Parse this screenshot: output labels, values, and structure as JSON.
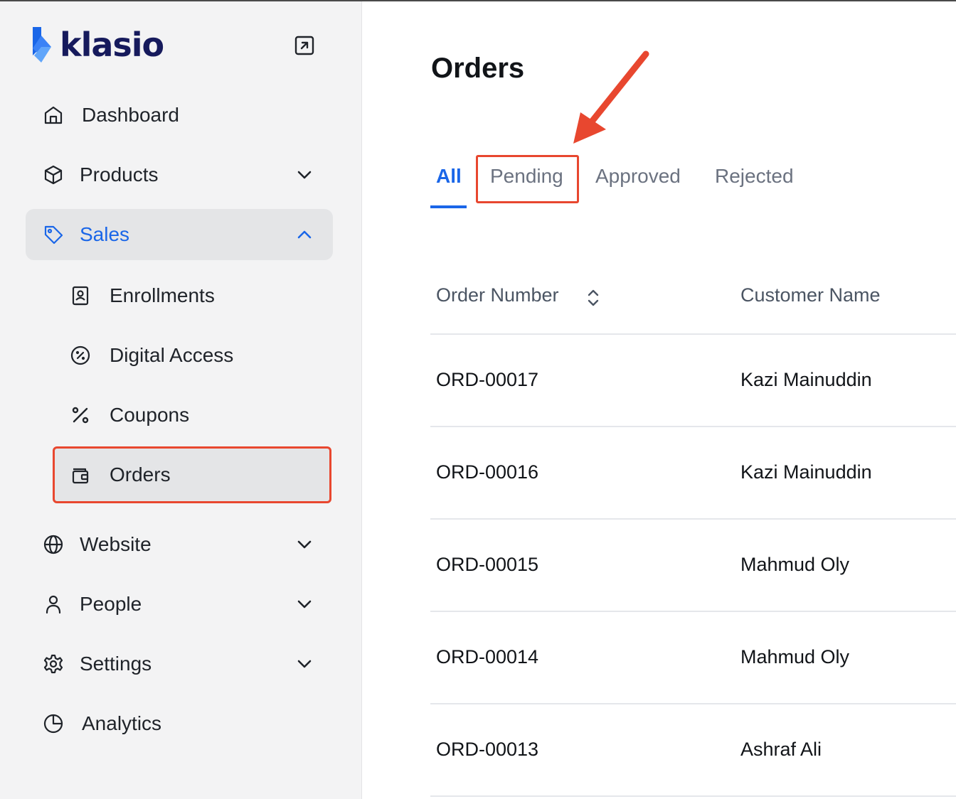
{
  "brand": {
    "name": "klasio",
    "logo_icon": "klasio-logo-icon",
    "colors": {
      "accent": "#1a66e8",
      "annotation": "#e8472f",
      "logo_text": "#161a5c"
    }
  },
  "sidebar": {
    "collapse_icon": "external-link-icon",
    "items": [
      {
        "label": "Dashboard",
        "icon": "home-icon"
      },
      {
        "label": "Products",
        "icon": "cube-icon",
        "chevron": "chevron-down-icon"
      },
      {
        "label": "Sales",
        "icon": "tag-icon",
        "chevron": "chevron-up-icon",
        "active": true,
        "children": [
          {
            "label": "Enrollments",
            "icon": "contact-book-icon"
          },
          {
            "label": "Digital Access",
            "icon": "percent-circle-icon"
          },
          {
            "label": "Coupons",
            "icon": "percent-icon"
          },
          {
            "label": "Orders",
            "icon": "wallet-icon",
            "current": true
          }
        ]
      },
      {
        "label": "Website",
        "icon": "globe-icon",
        "chevron": "chevron-down-icon"
      },
      {
        "label": "People",
        "icon": "user-icon",
        "chevron": "chevron-down-icon"
      },
      {
        "label": "Settings",
        "icon": "gear-icon",
        "chevron": "chevron-down-icon"
      },
      {
        "label": "Analytics",
        "icon": "pie-chart-icon"
      }
    ]
  },
  "main": {
    "title": "Orders",
    "tabs": [
      {
        "label": "All",
        "active": true
      },
      {
        "label": "Pending",
        "highlighted": true
      },
      {
        "label": "Approved"
      },
      {
        "label": "Rejected"
      }
    ],
    "table": {
      "columns": [
        "Order Number",
        "Customer Name"
      ],
      "sort_icon": "sort-icon",
      "rows": [
        [
          "ORD-00017",
          "Kazi Mainuddin"
        ],
        [
          "ORD-00016",
          "Kazi Mainuddin"
        ],
        [
          "ORD-00015",
          "Mahmud Oly"
        ],
        [
          "ORD-00014",
          "Mahmud Oly"
        ],
        [
          "ORD-00013",
          "Ashraf Ali"
        ]
      ]
    }
  }
}
